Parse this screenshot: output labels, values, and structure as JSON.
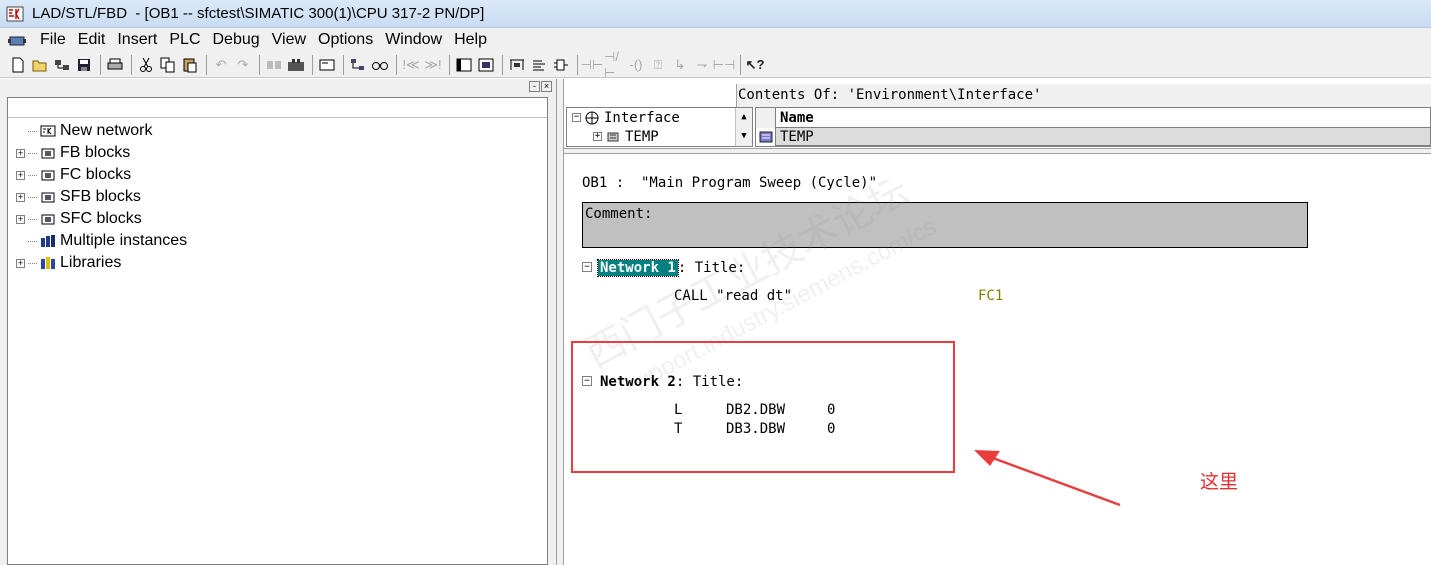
{
  "window": {
    "title": "LAD/STL/FBD  - [OB1 -- sfctest\\SIMATIC 300(1)\\CPU 317-2 PN/DP]"
  },
  "menu": {
    "items": [
      "File",
      "Edit",
      "Insert",
      "PLC",
      "Debug",
      "View",
      "Options",
      "Window",
      "Help"
    ]
  },
  "left_tree": {
    "items": [
      {
        "label": "New network",
        "expandable": false,
        "icon": "network-icon"
      },
      {
        "label": "FB blocks",
        "expandable": true,
        "icon": "block-icon"
      },
      {
        "label": "FC blocks",
        "expandable": true,
        "icon": "block-icon"
      },
      {
        "label": "SFB blocks",
        "expandable": true,
        "icon": "block-icon"
      },
      {
        "label": "SFC blocks",
        "expandable": true,
        "icon": "block-icon"
      },
      {
        "label": "Multiple instances",
        "expandable": false,
        "icon": "instances-icon"
      },
      {
        "label": "Libraries",
        "expandable": true,
        "icon": "library-icon"
      }
    ]
  },
  "interface": {
    "contents_of": "Contents Of: 'Environment\\Interface'",
    "root": "Interface",
    "child": "TEMP",
    "table_header": "Name",
    "table_row": "TEMP"
  },
  "editor": {
    "block_header": "OB1 :  \"Main Program Sweep (Cycle)\"",
    "comment_label": "Comment:",
    "network1": {
      "label": "Network 1",
      "title": ": Title:",
      "statement": "CALL \"read dt\"",
      "block_ref": "FC1"
    },
    "network2": {
      "label": "Network 2",
      "title": ": Title:",
      "lines": [
        {
          "op": "L",
          "operand": "DB2.DBW",
          "value": "0"
        },
        {
          "op": "T",
          "operand": "DB3.DBW",
          "value": "0"
        }
      ]
    }
  },
  "annotation": {
    "text": "这里",
    "color": "#e03030"
  },
  "colors": {
    "network_highlight": "#008080",
    "block_ref": "#808000",
    "annotation_box": "#e83e3e"
  }
}
